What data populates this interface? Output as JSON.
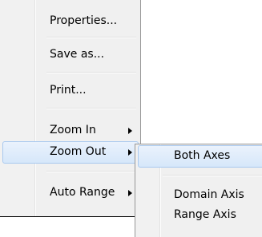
{
  "context_menu": {
    "items": [
      {
        "label": "Properties...",
        "has_submenu": false
      },
      {
        "label": "Save as...",
        "has_submenu": false
      },
      {
        "label": "Print...",
        "has_submenu": false
      },
      {
        "label": "Zoom In",
        "has_submenu": true
      },
      {
        "label": "Zoom Out",
        "has_submenu": true,
        "highlighted": true
      },
      {
        "label": "Auto Range",
        "has_submenu": true
      }
    ]
  },
  "submenu": {
    "items": [
      {
        "label": "Both Axes",
        "highlighted": true
      },
      {
        "label": "Domain Axis"
      },
      {
        "label": "Range Axis"
      }
    ]
  },
  "colors": {
    "menu_background": "#f0f0f0",
    "highlight_border": "#a9c9ef",
    "highlight_fill": "#d6e7fa"
  }
}
